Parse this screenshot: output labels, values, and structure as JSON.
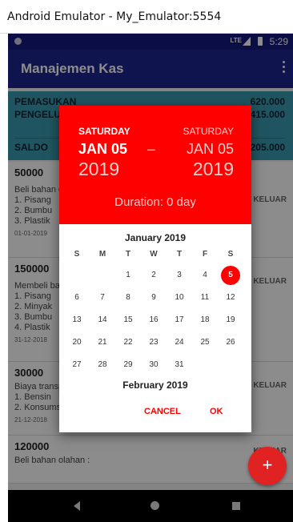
{
  "window": {
    "title": "Android Emulator - My_Emulator:5554"
  },
  "statusbar": {
    "network": "LTE",
    "time": "5:29"
  },
  "appbar": {
    "title": "Manajemen Kas"
  },
  "summary": {
    "pemasukan_label": "PEMASUKAN",
    "pemasukan_value": "620.000",
    "pengeluaran_label": "PENGELUARAN",
    "pengeluaran_value": "415.000",
    "saldo_label": "SALDO",
    "saldo_value": "205.000"
  },
  "transactions": [
    {
      "amount": "50000",
      "desc": "Beli bahan olahan :\n1. Pisang\n2. Bumbu\n3. Plastik",
      "date": "01-01-2019",
      "type": "KELUAR"
    },
    {
      "amount": "150000",
      "desc": "Membeli bahan :\n1. Pisang\n2. Minyak\n3. Bumbu\n4. Plastik",
      "date": "31-12-2018",
      "type": "KELUAR"
    },
    {
      "amount": "30000",
      "desc": "Biaya transport :\n1. Bensin\n2. Konsumsi",
      "date": "21-12-2018",
      "type": "KELUAR"
    },
    {
      "amount": "120000",
      "desc": "Beli bahan olahan :",
      "date": "",
      "type": "KELUAR"
    }
  ],
  "fab": {
    "icon": "plus-icon",
    "label": "+"
  },
  "dialog": {
    "start_day": "SATURDAY",
    "start_date": "JAN 05",
    "start_year": "2019",
    "separator": "–",
    "end_day": "SATURDAY",
    "end_date": "JAN 05",
    "end_year": "2019",
    "duration": "Duration: 0 day",
    "month": "January 2019",
    "next_month": "February 2019",
    "weekdays": [
      "S",
      "M",
      "T",
      "W",
      "T",
      "F",
      "S"
    ],
    "days": [
      "1",
      "2",
      "3",
      "4",
      "5",
      "6",
      "7",
      "8",
      "9",
      "10",
      "11",
      "12",
      "13",
      "14",
      "15",
      "16",
      "17",
      "18",
      "19",
      "20",
      "21",
      "22",
      "23",
      "24",
      "25",
      "26",
      "27",
      "28",
      "29",
      "30",
      "31"
    ],
    "selected_day": "5",
    "cancel_label": "CANCEL",
    "ok_label": "OK",
    "accent_color": "#ff0000"
  }
}
